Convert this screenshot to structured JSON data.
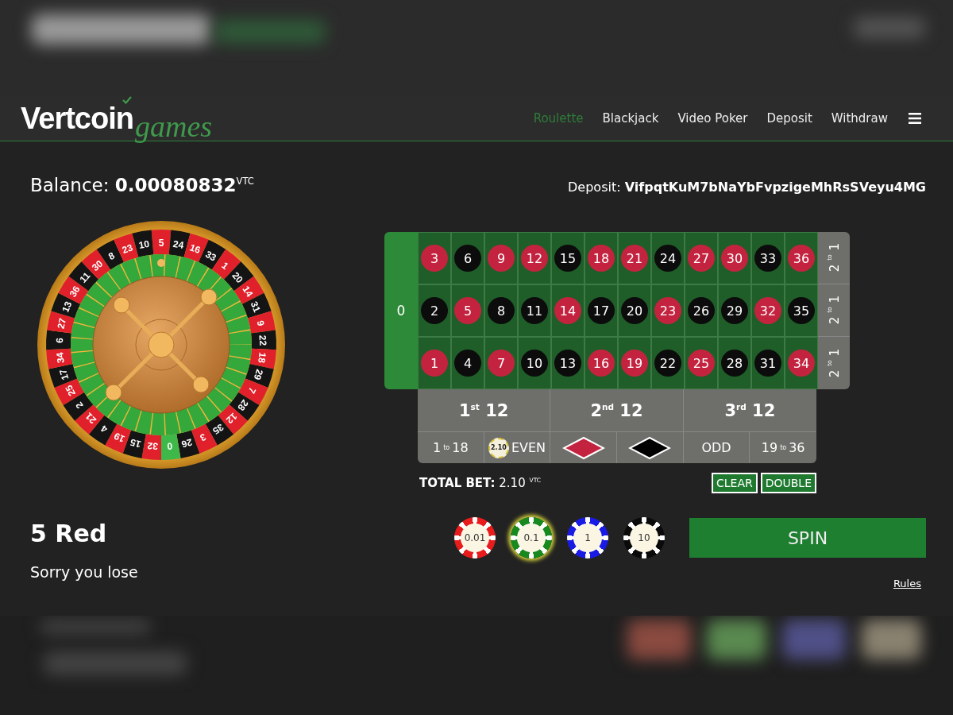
{
  "nav": {
    "logo": {
      "word": "Vertcoin",
      "script": "games"
    },
    "links": [
      {
        "label": "Roulette",
        "selected": true
      },
      {
        "label": "Blackjack",
        "selected": false
      },
      {
        "label": "Video Poker",
        "selected": false
      },
      {
        "label": "Deposit",
        "selected": false
      },
      {
        "label": "Withdraw",
        "selected": false
      }
    ]
  },
  "balance": {
    "label": "Balance:",
    "amount": "0.00080832",
    "unit": "VTC"
  },
  "deposit": {
    "label": "Deposit:",
    "address": "VifpqtKuM7bNaYbFvpzigeMhRsSVeyu4MG"
  },
  "wheel": {
    "pockets": [
      {
        "number": "5",
        "color": "#e0202a"
      },
      {
        "number": "24",
        "color": "#141414"
      },
      {
        "number": "16",
        "color": "#e0202a"
      },
      {
        "number": "33",
        "color": "#141414"
      },
      {
        "number": "1",
        "color": "#e0202a"
      },
      {
        "number": "20",
        "color": "#141414"
      },
      {
        "number": "14",
        "color": "#e0202a"
      },
      {
        "number": "31",
        "color": "#141414"
      },
      {
        "number": "9",
        "color": "#e0202a"
      },
      {
        "number": "22",
        "color": "#141414"
      },
      {
        "number": "18",
        "color": "#e0202a"
      },
      {
        "number": "29",
        "color": "#141414"
      },
      {
        "number": "7",
        "color": "#e0202a"
      },
      {
        "number": "28",
        "color": "#141414"
      },
      {
        "number": "12",
        "color": "#e0202a"
      },
      {
        "number": "35",
        "color": "#141414"
      },
      {
        "number": "3",
        "color": "#e0202a"
      },
      {
        "number": "26",
        "color": "#141414"
      },
      {
        "number": "0",
        "color": "#3fb84a"
      },
      {
        "number": "32",
        "color": "#e0202a"
      },
      {
        "number": "15",
        "color": "#141414"
      },
      {
        "number": "19",
        "color": "#e0202a"
      },
      {
        "number": "4",
        "color": "#141414"
      },
      {
        "number": "21",
        "color": "#e0202a"
      },
      {
        "number": "2",
        "color": "#141414"
      },
      {
        "number": "25",
        "color": "#e0202a"
      },
      {
        "number": "17",
        "color": "#141414"
      },
      {
        "number": "34",
        "color": "#e0202a"
      },
      {
        "number": "6",
        "color": "#141414"
      },
      {
        "number": "27",
        "color": "#e0202a"
      },
      {
        "number": "13",
        "color": "#141414"
      },
      {
        "number": "36",
        "color": "#e0202a"
      },
      {
        "number": "11",
        "color": "#141414"
      },
      {
        "number": "30",
        "color": "#e0202a"
      },
      {
        "number": "8",
        "color": "#141414"
      },
      {
        "number": "23",
        "color": "#e0202a"
      },
      {
        "number": "10",
        "color": "#141414"
      }
    ]
  },
  "table": {
    "zero": "0",
    "number_rows": [
      [
        {
          "number": "3",
          "color": "#c4233f"
        },
        {
          "number": "6",
          "color": "#0c0c0c"
        },
        {
          "number": "9",
          "color": "#c4233f"
        },
        {
          "number": "12",
          "color": "#c4233f"
        },
        {
          "number": "15",
          "color": "#0c0c0c"
        },
        {
          "number": "18",
          "color": "#c4233f"
        },
        {
          "number": "21",
          "color": "#c4233f"
        },
        {
          "number": "24",
          "color": "#0c0c0c"
        },
        {
          "number": "27",
          "color": "#c4233f"
        },
        {
          "number": "30",
          "color": "#c4233f"
        },
        {
          "number": "33",
          "color": "#0c0c0c"
        },
        {
          "number": "36",
          "color": "#c4233f"
        }
      ],
      [
        {
          "number": "2",
          "color": "#0c0c0c"
        },
        {
          "number": "5",
          "color": "#c4233f"
        },
        {
          "number": "8",
          "color": "#0c0c0c"
        },
        {
          "number": "11",
          "color": "#0c0c0c"
        },
        {
          "number": "14",
          "color": "#c4233f"
        },
        {
          "number": "17",
          "color": "#0c0c0c"
        },
        {
          "number": "20",
          "color": "#0c0c0c"
        },
        {
          "number": "23",
          "color": "#c4233f"
        },
        {
          "number": "26",
          "color": "#0c0c0c"
        },
        {
          "number": "29",
          "color": "#0c0c0c"
        },
        {
          "number": "32",
          "color": "#c4233f"
        },
        {
          "number": "35",
          "color": "#0c0c0c"
        }
      ],
      [
        {
          "number": "1",
          "color": "#c4233f"
        },
        {
          "number": "4",
          "color": "#0c0c0c"
        },
        {
          "number": "7",
          "color": "#c4233f"
        },
        {
          "number": "10",
          "color": "#0c0c0c"
        },
        {
          "number": "13",
          "color": "#0c0c0c"
        },
        {
          "number": "16",
          "color": "#c4233f"
        },
        {
          "number": "19",
          "color": "#c4233f"
        },
        {
          "number": "22",
          "color": "#0c0c0c"
        },
        {
          "number": "25",
          "color": "#c4233f"
        },
        {
          "number": "28",
          "color": "#0c0c0c"
        },
        {
          "number": "31",
          "color": "#0c0c0c"
        },
        {
          "number": "34",
          "color": "#c4233f"
        }
      ]
    ],
    "column_bets": [
      "2 $^{to}$ 1",
      "2 $^{to}$ 1",
      "2 $^{to}$ 1"
    ],
    "dozens": [
      "1$^{st}$ 12",
      "2$^{nd}$ 12",
      "3$^{rd}$ 12"
    ],
    "outside": [
      {
        "kind": "text",
        "label": "1 $^{to}$ 18"
      },
      {
        "kind": "text",
        "label": "EVEN",
        "bet_chip": "2.10"
      },
      {
        "kind": "diamond",
        "color": "#c4233f"
      },
      {
        "kind": "diamond",
        "color": "#000000"
      },
      {
        "kind": "text",
        "label": "ODD"
      },
      {
        "kind": "text",
        "label": "19 $^{to}$ 36"
      }
    ]
  },
  "total_bet": {
    "label": "TOTAL BET:",
    "amount": "2.10",
    "unit": "VTC"
  },
  "actions": [
    "CLEAR",
    "DOUBLE"
  ],
  "result": {
    "title": "5 Red",
    "message": "Sorry you lose"
  },
  "chips": [
    {
      "value": "0.01",
      "color": "#e81c1c",
      "selected": false
    },
    {
      "value": "0.1",
      "color": "#17891f",
      "selected": true
    },
    {
      "value": "1",
      "color": "#1a1ae6",
      "selected": false
    },
    {
      "value": "10",
      "color": "#0a0a0a",
      "selected": false
    }
  ],
  "spin": "SPIN",
  "rules": "Rules"
}
